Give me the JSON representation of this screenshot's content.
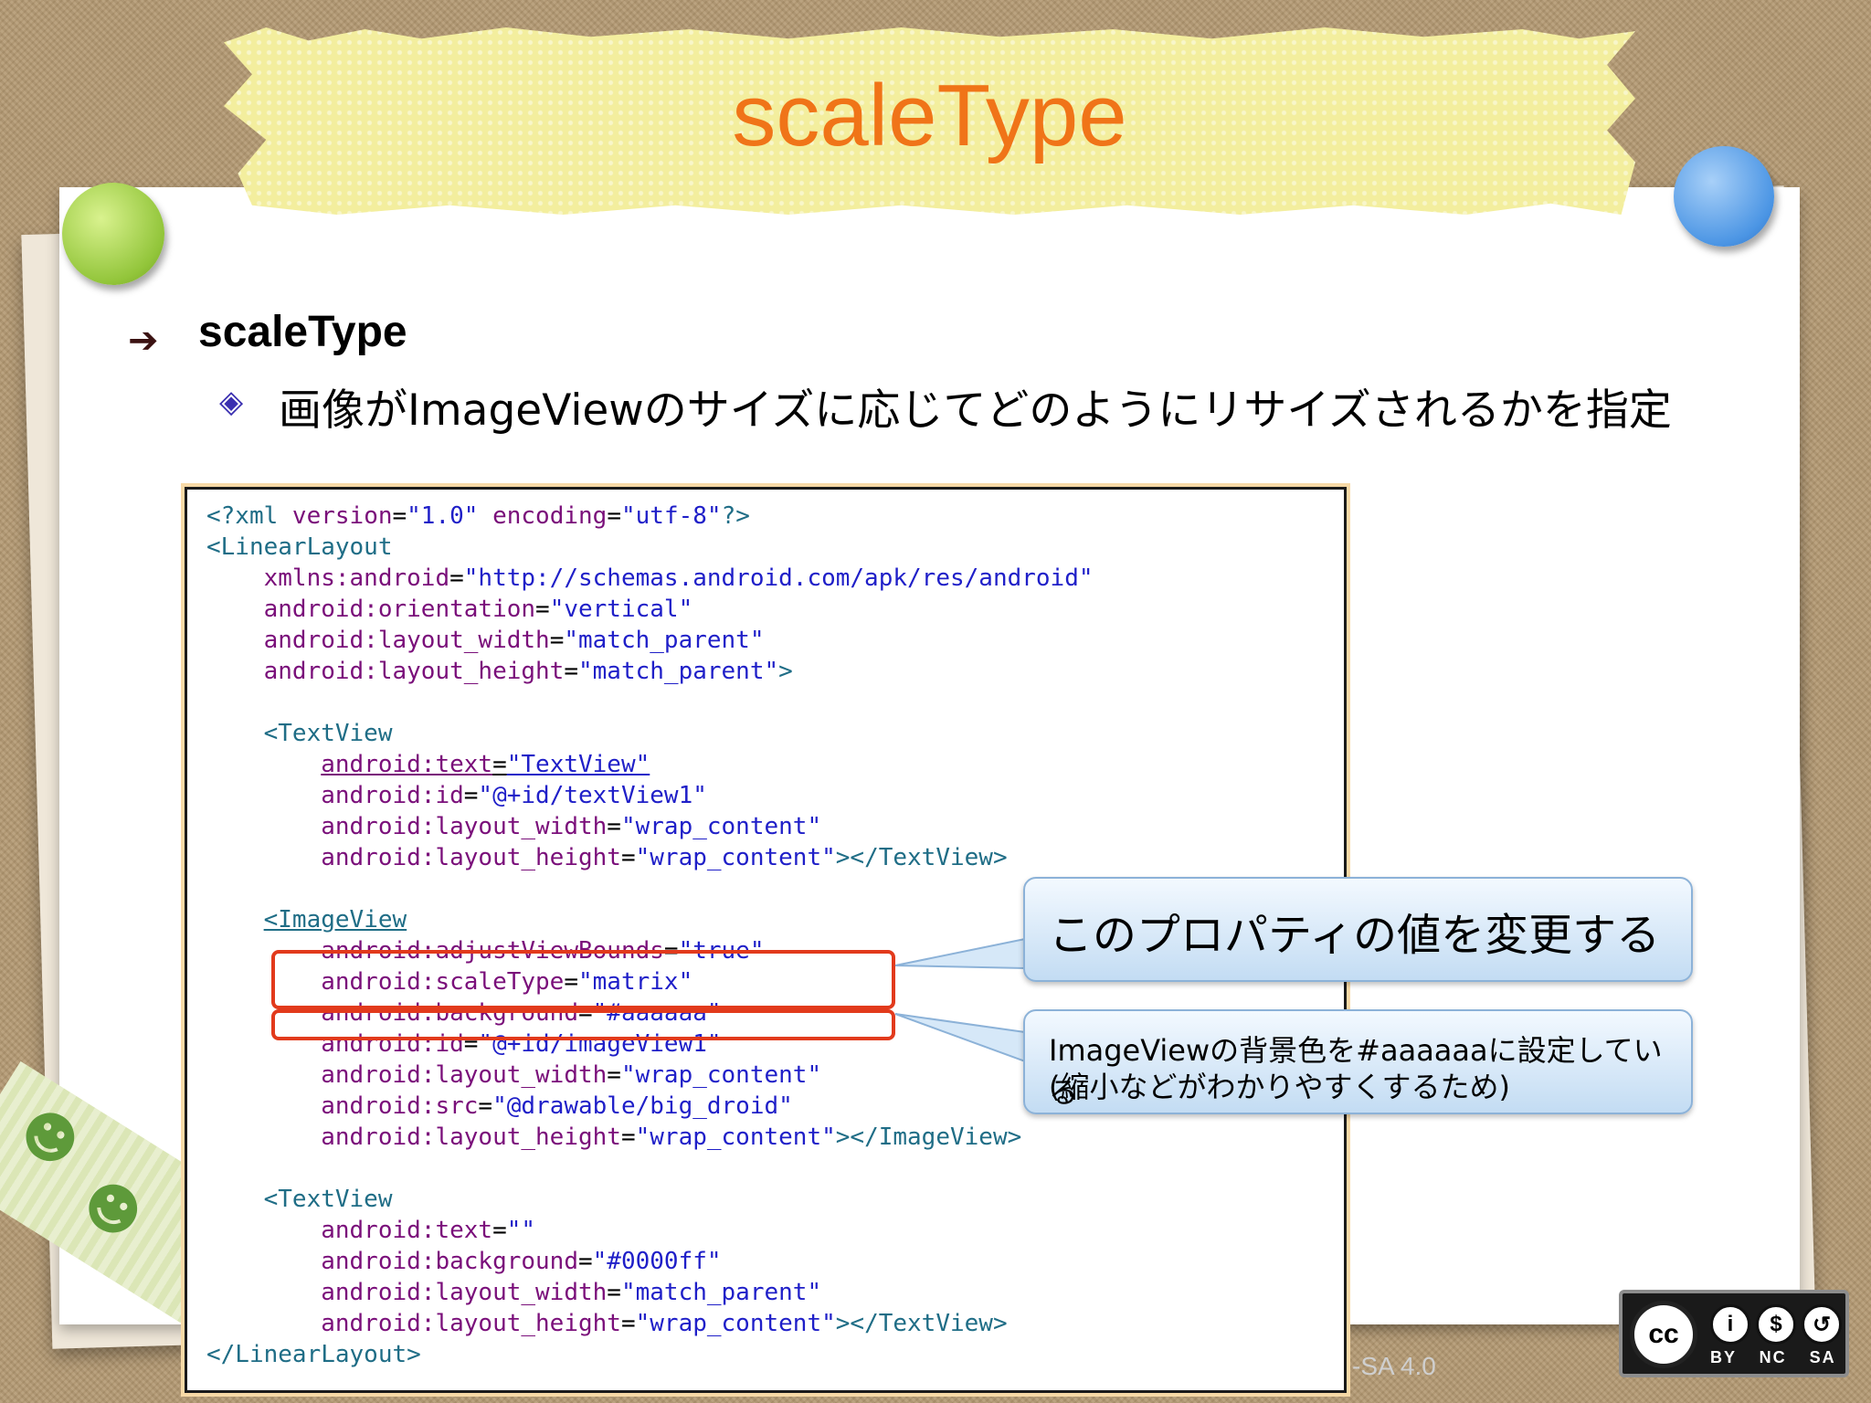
{
  "slide": {
    "title": "scaleType",
    "heading": "scaleType",
    "subpoint": "画像がImageViewのサイズに応じてどのようにリサイズされるかを指定"
  },
  "code": {
    "lines": [
      [
        {
          "t": "<?xml ",
          "c": "t"
        },
        {
          "t": "version",
          "c": "a"
        },
        {
          "t": "=",
          "c": "n"
        },
        {
          "t": "\"1.0\"",
          "c": "v"
        },
        {
          "t": " encoding",
          "c": "a"
        },
        {
          "t": "=",
          "c": "n"
        },
        {
          "t": "\"utf-8\"",
          "c": "v"
        },
        {
          "t": "?>",
          "c": "t"
        }
      ],
      [
        {
          "t": "<LinearLayout",
          "c": "t"
        }
      ],
      [
        {
          "t": "    xmlns:android",
          "c": "a"
        },
        {
          "t": "=",
          "c": "n"
        },
        {
          "t": "\"http://schemas.android.com/apk/res/android\"",
          "c": "v"
        }
      ],
      [
        {
          "t": "    android:orientation",
          "c": "a"
        },
        {
          "t": "=",
          "c": "n"
        },
        {
          "t": "\"vertical\"",
          "c": "v"
        }
      ],
      [
        {
          "t": "    android:layout_width",
          "c": "a"
        },
        {
          "t": "=",
          "c": "n"
        },
        {
          "t": "\"match_parent\"",
          "c": "v"
        }
      ],
      [
        {
          "t": "    android:layout_height",
          "c": "a"
        },
        {
          "t": "=",
          "c": "n"
        },
        {
          "t": "\"match_parent\"",
          "c": "v"
        },
        {
          "t": ">",
          "c": "t"
        }
      ],
      [],
      [
        {
          "t": "    <TextView",
          "c": "t"
        }
      ],
      [
        {
          "t": "        ",
          "c": "n"
        },
        {
          "t": "android:text",
          "c": "a u"
        },
        {
          "t": "=",
          "c": "n u"
        },
        {
          "t": "\"TextView\"",
          "c": "v u"
        }
      ],
      [
        {
          "t": "        android:id",
          "c": "a"
        },
        {
          "t": "=",
          "c": "n"
        },
        {
          "t": "\"@+id/textView1\"",
          "c": "v"
        }
      ],
      [
        {
          "t": "        android:layout_width",
          "c": "a"
        },
        {
          "t": "=",
          "c": "n"
        },
        {
          "t": "\"wrap_content\"",
          "c": "v"
        }
      ],
      [
        {
          "t": "        android:layout_height",
          "c": "a"
        },
        {
          "t": "=",
          "c": "n"
        },
        {
          "t": "\"wrap_content\"",
          "c": "v"
        },
        {
          "t": "></TextView>",
          "c": "t"
        }
      ],
      [],
      [
        {
          "t": "    ",
          "c": "n"
        },
        {
          "t": "<ImageView",
          "c": "t u"
        }
      ],
      [
        {
          "t": "        android:adjustViewBounds",
          "c": "a"
        },
        {
          "t": "=",
          "c": "n"
        },
        {
          "t": "\"true\"",
          "c": "v"
        }
      ],
      [
        {
          "t": "        android:scaleType",
          "c": "a"
        },
        {
          "t": "=",
          "c": "n"
        },
        {
          "t": "\"matrix\"",
          "c": "v"
        }
      ],
      [
        {
          "t": "        android:background",
          "c": "a"
        },
        {
          "t": "=",
          "c": "n"
        },
        {
          "t": "\"#aaaaaa\"",
          "c": "v"
        }
      ],
      [
        {
          "t": "        android:id",
          "c": "a"
        },
        {
          "t": "=",
          "c": "n"
        },
        {
          "t": "\"@+id/imageView1\"",
          "c": "v"
        }
      ],
      [
        {
          "t": "        android:layout_width",
          "c": "a"
        },
        {
          "t": "=",
          "c": "n"
        },
        {
          "t": "\"wrap_content\"",
          "c": "v"
        }
      ],
      [
        {
          "t": "        android:src",
          "c": "a"
        },
        {
          "t": "=",
          "c": "n"
        },
        {
          "t": "\"@drawable/big_droid\"",
          "c": "v"
        }
      ],
      [
        {
          "t": "        android:layout_height",
          "c": "a"
        },
        {
          "t": "=",
          "c": "n"
        },
        {
          "t": "\"wrap_content\"",
          "c": "v"
        },
        {
          "t": "></ImageView>",
          "c": "t"
        }
      ],
      [],
      [
        {
          "t": "    <TextView",
          "c": "t"
        }
      ],
      [
        {
          "t": "        android:text",
          "c": "a"
        },
        {
          "t": "=",
          "c": "n"
        },
        {
          "t": "\"\"",
          "c": "v"
        }
      ],
      [
        {
          "t": "        android:background",
          "c": "a"
        },
        {
          "t": "=",
          "c": "n"
        },
        {
          "t": "\"#0000ff\"",
          "c": "v"
        }
      ],
      [
        {
          "t": "        android:layout_width",
          "c": "a"
        },
        {
          "t": "=",
          "c": "n"
        },
        {
          "t": "\"match_parent\"",
          "c": "v"
        }
      ],
      [
        {
          "t": "        android:layout_height",
          "c": "a"
        },
        {
          "t": "=",
          "c": "n"
        },
        {
          "t": "\"wrap_content\"",
          "c": "v"
        },
        {
          "t": "></TextView>",
          "c": "t"
        }
      ],
      [
        {
          "t": "</LinearLayout>",
          "c": "t"
        }
      ]
    ]
  },
  "callouts": {
    "change_value": "このプロパティの値を変更する",
    "background_line1": "ImageViewの背景色を#aaaaaaに設定している",
    "background_line2": "(縮小などがわかりやすくするため)"
  },
  "license": {
    "text": "-SA 4.0",
    "badge_words": "BY NC SA",
    "cc_label": "cc",
    "icons": [
      "person-icon",
      "no-dollar-icon",
      "share-alike-icon"
    ]
  },
  "colors": {
    "title": "#f07418",
    "tag": "#1f6d86",
    "attribute": "#7a0f7a",
    "value": "#1f1fc8",
    "highlight": "#e23a1c"
  }
}
